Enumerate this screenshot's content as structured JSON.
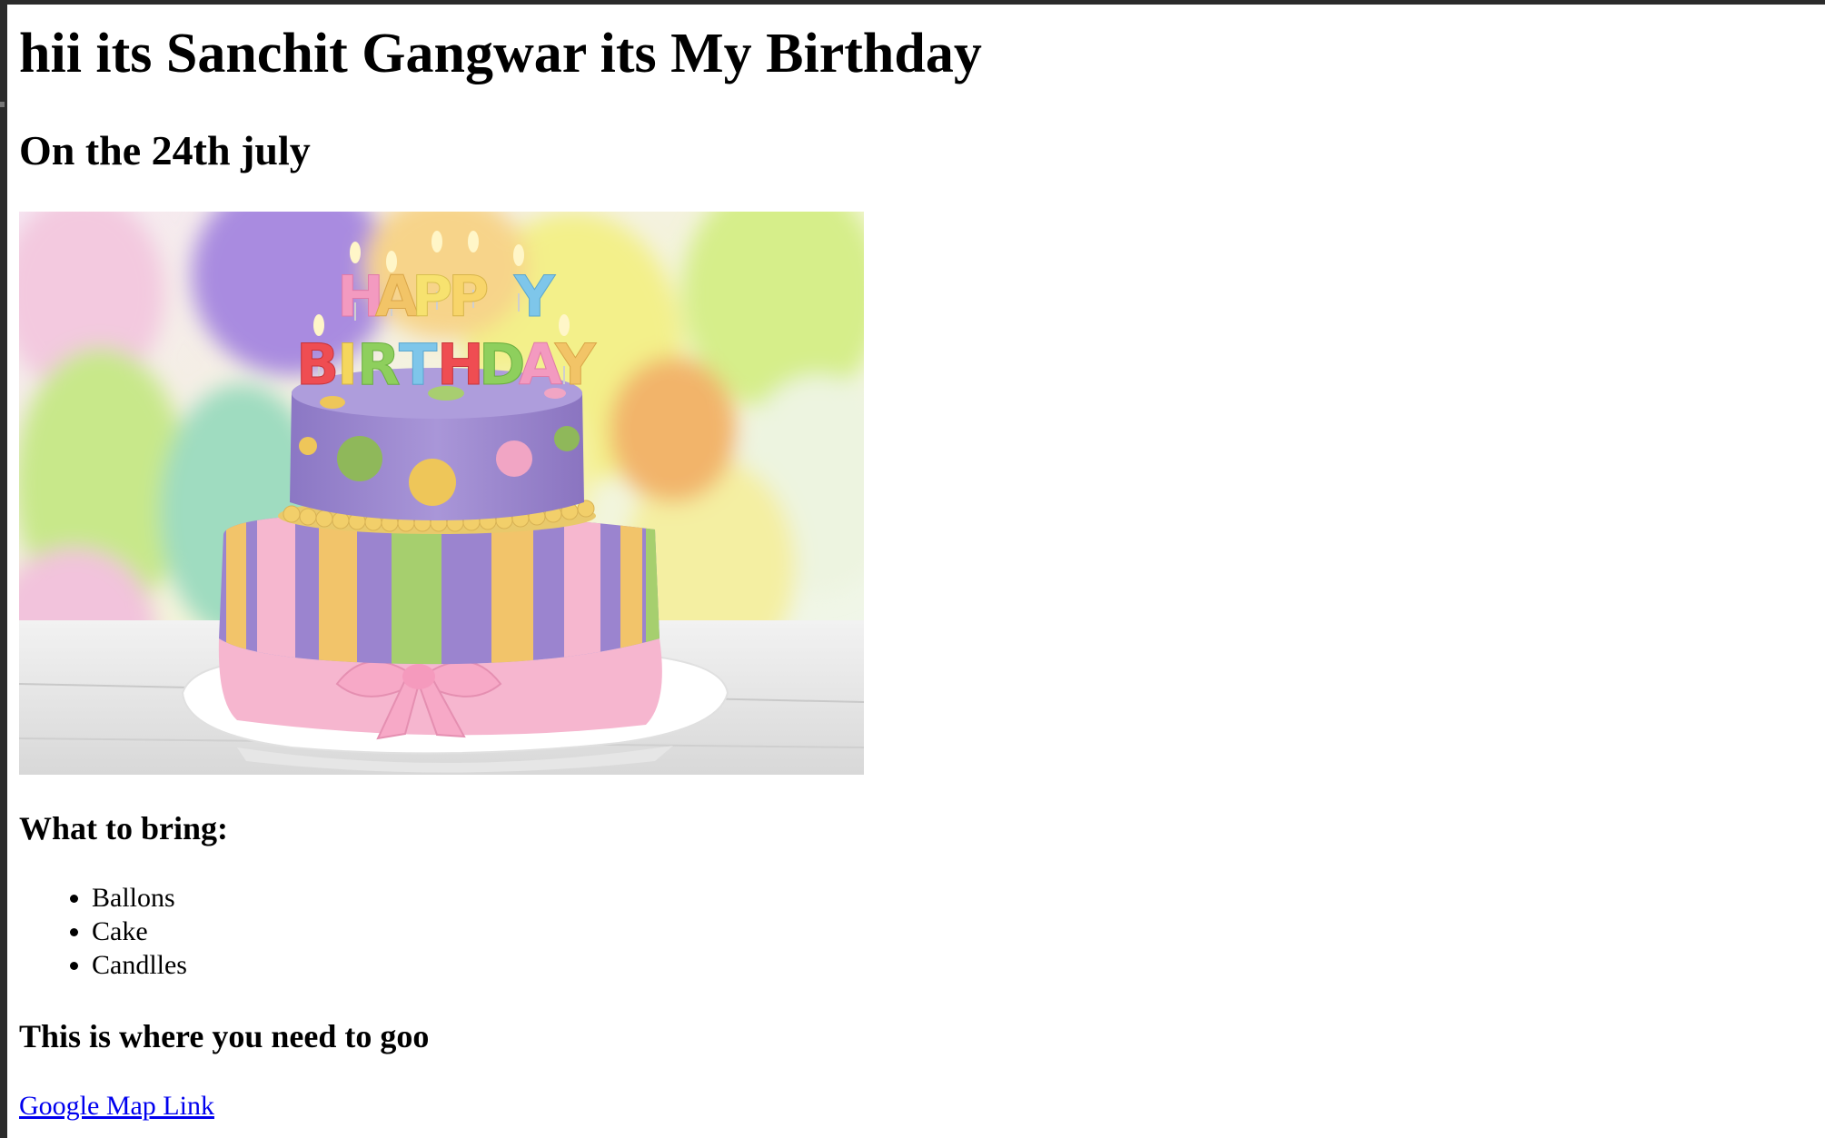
{
  "page": {
    "heading": "hii its Sanchit Gangwar its My Birthday",
    "date_heading": "On the 24th july",
    "photo_caption_text": "HAPPY BIRTHDAY",
    "bring_heading": "What to bring:",
    "bring_items": [
      "Ballons",
      "Cake",
      "Candlles"
    ],
    "where_heading": "This is where you need to goo",
    "map_link_label": "Google Map Link"
  },
  "colors": {
    "link": "#0000ee",
    "frame": "#2b2b2b"
  }
}
